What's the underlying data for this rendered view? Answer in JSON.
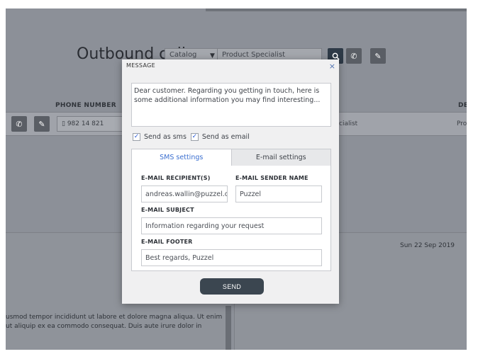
{
  "app": {
    "page_title": "Outbound call",
    "catalog_select": "Catalog",
    "queue_select": "Product Specialist",
    "column_phone": "PHONE NUMBER",
    "column_dept": "DEPA",
    "row_phone": "982 14 821",
    "row_queue": "cialist",
    "row_dept": "Prod",
    "date": "Sun 22 Sep 2019",
    "body_text": "usmod tempor incididunt ut labore et dolore magna aliqua. Ut enim ut aliquip ex ea commodo consequat. Duis aute irure dolor in"
  },
  "modal": {
    "title": "MESSAGE",
    "close": "×",
    "message": "Dear customer. Regarding you getting in touch, here is some additional information you may find interesting...",
    "send_as_sms": "Send as sms",
    "send_as_email": "Send as email",
    "tab_sms": "SMS settings",
    "tab_email": "E-mail settings",
    "label_recipients": "E-MAIL RECIPIENT(S)",
    "label_sender": "E-MAIL SENDER NAME",
    "label_subject": "E-MAIL SUBJECT",
    "label_footer": "E-MAIL FOOTER",
    "value_recipients": "andreas.wallin@puzzel.com",
    "value_sender": "Puzzel",
    "value_subject": "Information regarding your request",
    "value_footer": "Best regards, Puzzel",
    "send": "SEND"
  },
  "colors": {
    "accent": "#3b6fd0",
    "send_button": "#3b4650"
  }
}
